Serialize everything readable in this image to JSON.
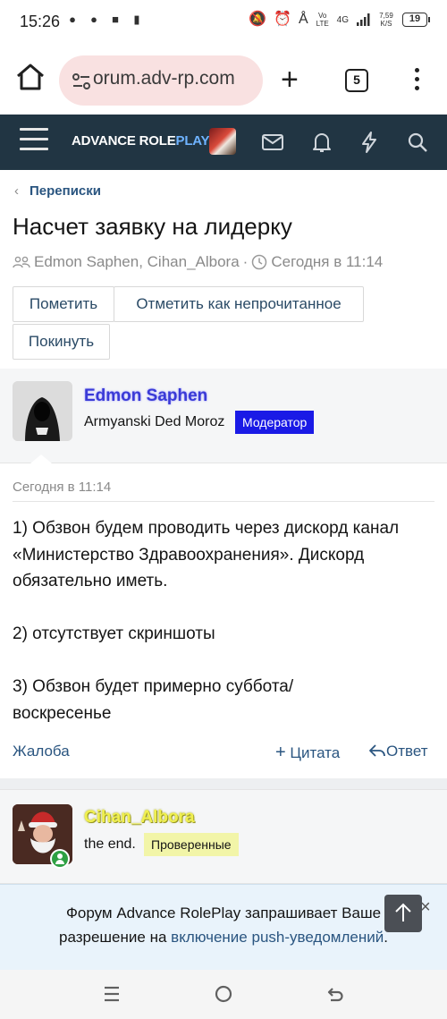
{
  "status_bar": {
    "time": "15:26",
    "net_type": "Vo LTE",
    "signal": "4G",
    "speed_value": "7,59",
    "speed_unit": "K/S",
    "battery": "19"
  },
  "browser": {
    "url": "orum.adv-rp.com",
    "tab_count": "5"
  },
  "forum_header": {
    "logo_part1": "ADVANCE ",
    "logo_part2": "ROLE",
    "logo_part3": "PLAY"
  },
  "breadcrumb": {
    "label": "Переписки"
  },
  "thread": {
    "title": "Насчет заявку на лидерку",
    "participants": "Edmon Saphen, Cihan_Albora",
    "date": "Сегодня в 11:14"
  },
  "buttons": {
    "mark": "Пометить",
    "mark_unread": "Отметить как непрочитанное",
    "leave": "Покинуть"
  },
  "posts": [
    {
      "username": "Edmon Saphen",
      "user_title": "Armyanski Ded Moroz",
      "badge": "Модератор",
      "date": "Сегодня в 11:14",
      "body": [
        "1) Обзвон будем проводить через дискорд канал «Министерство Здравоохранения». Дискорд обязательно иметь.",
        "2) отсутствует скриншоты",
        "3) Обзвон будет примерно суббота/воскресенье"
      ],
      "actions": {
        "report": "Жалоба",
        "quote": "Цитата",
        "reply": "Ответ"
      }
    },
    {
      "username": "Cihan_Albora",
      "user_title": "the end.",
      "badge": "Проверенные"
    }
  ],
  "push_banner": {
    "text_before": "Форум Advance RolePlay запрашивает Ваше разрешение на ",
    "link": "включение push-уведомлений",
    "text_after": "."
  },
  "colors": {
    "header_bg": "#213543",
    "link": "#2a5580",
    "moderator_badge": "#1a1ae6",
    "verified_badge": "#f2f5a8",
    "username_blue": "#3a3ad6",
    "username_yellow": "#f0f050"
  }
}
